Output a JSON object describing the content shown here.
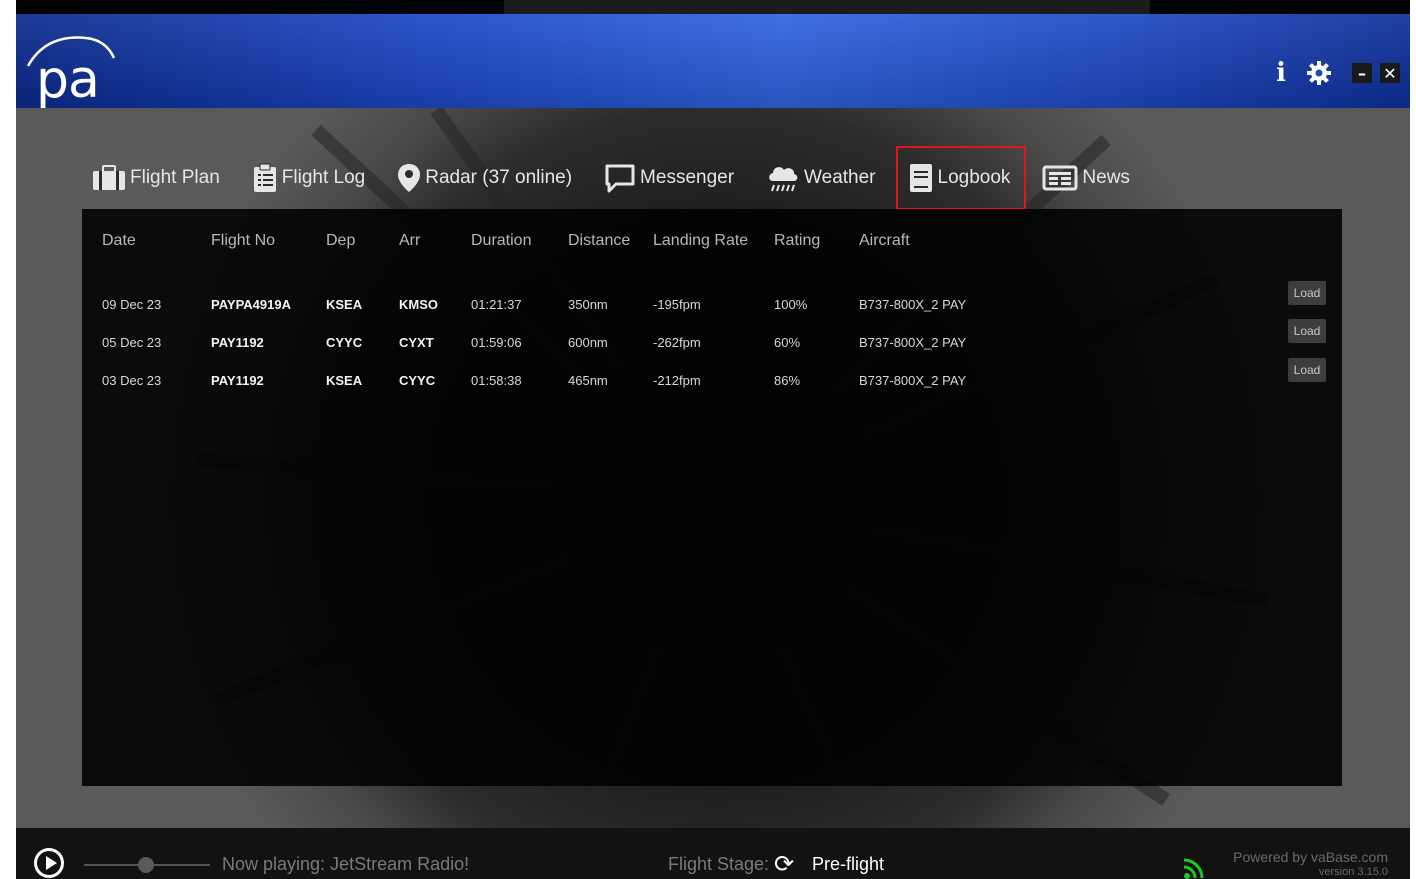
{
  "app": {
    "logo_text": "pa"
  },
  "header": {
    "info_icon": "info-icon",
    "settings_icon": "gear-icon",
    "minimize_label": "–",
    "close_label": "✕"
  },
  "nav": {
    "items": [
      {
        "label": "Flight Plan",
        "icon": "clipboard-icon"
      },
      {
        "label": "Flight Log",
        "icon": "flight-log-icon"
      },
      {
        "label": "Radar (37 online)",
        "icon": "map-pin-icon"
      },
      {
        "label": "Messenger",
        "icon": "chat-bubble-icon"
      },
      {
        "label": "Weather",
        "icon": "cloud-rain-icon"
      },
      {
        "label": "Logbook",
        "icon": "book-icon"
      },
      {
        "label": "News",
        "icon": "newspaper-icon"
      }
    ],
    "active": "Logbook",
    "highlight_color": "#e0161a"
  },
  "logbook": {
    "columns": [
      "Date",
      "Flight No",
      "Dep",
      "Arr",
      "Duration",
      "Distance",
      "Landing Rate",
      "Rating",
      "Aircraft"
    ],
    "rows": [
      {
        "date": "09 Dec 23",
        "flight_no": "PAYPA4919A",
        "dep": "KSEA",
        "arr": "KMSO",
        "duration": "01:21:37",
        "distance": "350nm",
        "landing_rate": "-195fpm",
        "rating": "100%",
        "aircraft": "B737-800X_2 PAY",
        "action": "Load"
      },
      {
        "date": "05 Dec 23",
        "flight_no": "PAY1192",
        "dep": "CYYC",
        "arr": "CYXT",
        "duration": "01:59:06",
        "distance": "600nm",
        "landing_rate": "-262fpm",
        "rating": "60%",
        "aircraft": "B737-800X_2 PAY",
        "action": "Load"
      },
      {
        "date": "03 Dec 23",
        "flight_no": "PAY1192",
        "dep": "KSEA",
        "arr": "CYYC",
        "duration": "01:58:38",
        "distance": "465nm",
        "landing_rate": "-212fpm",
        "rating": "86%",
        "aircraft": "B737-800X_2 PAY",
        "action": "Load"
      }
    ]
  },
  "footer": {
    "now_playing": "Now playing: JetStream Radio!",
    "stage_label": "Flight Stage:",
    "stage_value": "Pre-flight",
    "stage_icon": "refresh-icon",
    "rss_icon": "rss-icon",
    "rss_color": "#1ec81e",
    "powered_by": "Powered by vaBase.com",
    "version": "version 3.15.0"
  },
  "colors": {
    "header_blue": "#1c47c8",
    "panel_bg": "#000000"
  }
}
